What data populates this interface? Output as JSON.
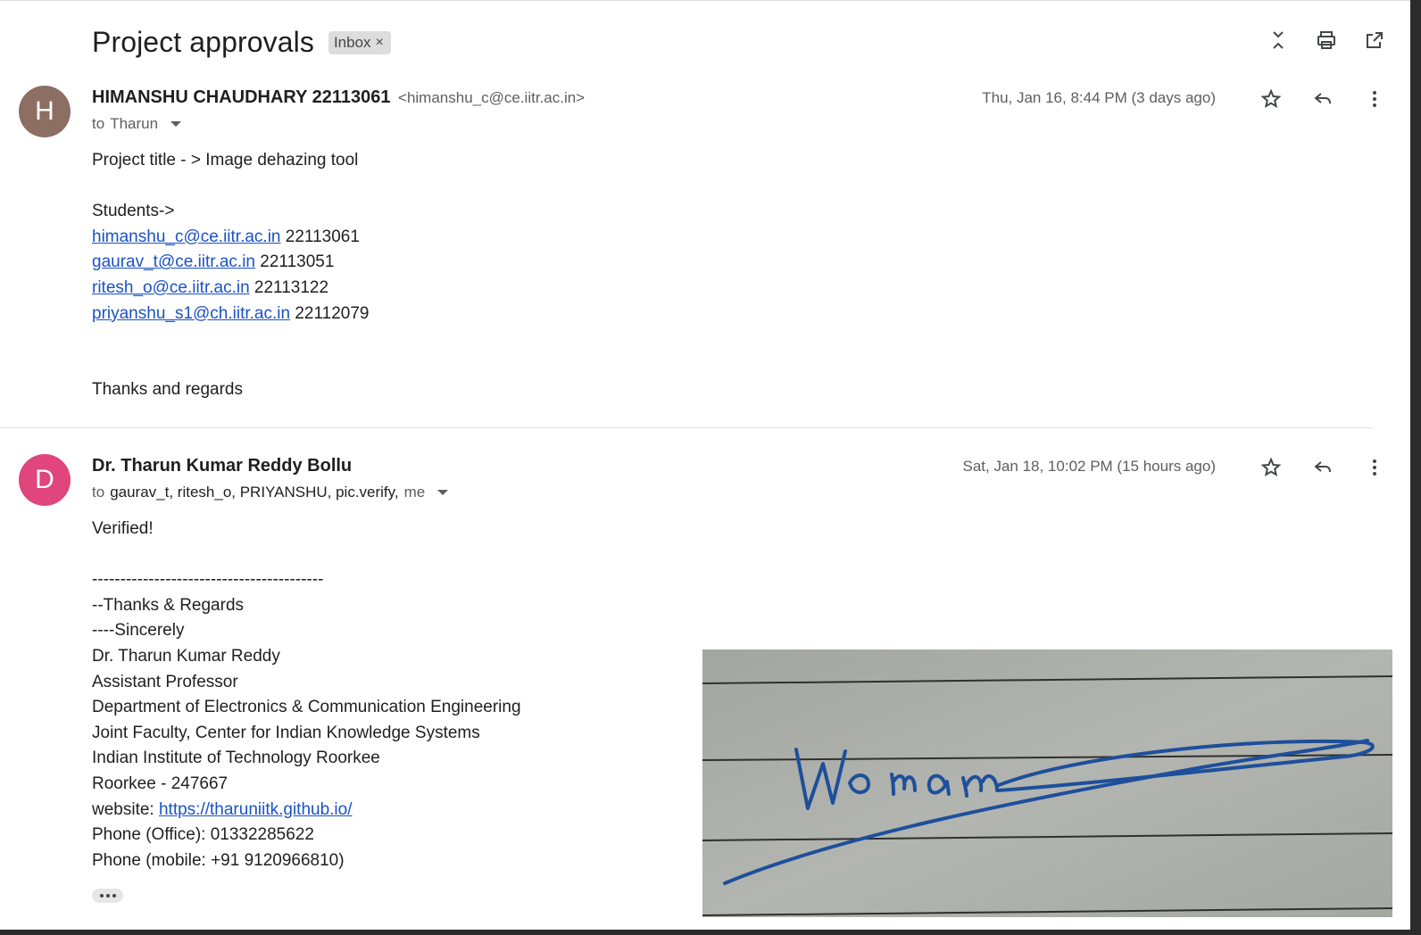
{
  "thread": {
    "subject": "Project approvals",
    "label": "Inbox",
    "label_remove": "×"
  },
  "toolbar_icons": [
    "collapse-all-icon",
    "print-icon",
    "open-in-new-window-icon"
  ],
  "messages": [
    {
      "avatar_letter": "H",
      "avatar_color": "#8c6e63",
      "sender_name": "HIMANSHU CHAUDHARY 22113061",
      "sender_email": "<himanshu_c@ce.iitr.ac.in>",
      "to_prefix": "to",
      "to_names": "Tharun",
      "date": "Thu, Jan 16, 8:44 PM (3 days ago)",
      "body": {
        "line1": "Project title - > Image dehazing tool",
        "line2": "Students->",
        "students": [
          {
            "email": "himanshu_c@ce.iitr.ac.in",
            "id": "22113061"
          },
          {
            "email": "gaurav_t@ce.iitr.ac.in",
            "id": "22113051"
          },
          {
            "email": "ritesh_o@ce.iitr.ac.in",
            "id": "22113122"
          },
          {
            "email": "priyanshu_s1@ch.iitr.ac.in",
            "id": "22112079"
          }
        ],
        "closing": "Thanks and regards"
      }
    },
    {
      "avatar_letter": "D",
      "avatar_color": "#e0457b",
      "sender_name": "Dr. Tharun Kumar Reddy Bollu",
      "to_prefix": "to",
      "to_names": "gaurav_t, ritesh_o, PRIYANSHU, pic.verify,",
      "to_me": "me",
      "date": "Sat, Jan 18, 10:02 PM (15 hours ago)",
      "body": {
        "line1": "Verified!",
        "separator": "-----------------------------------------",
        "sig1": "--Thanks & Regards",
        "sig2": "----Sincerely",
        "sig3": "Dr. Tharun Kumar Reddy",
        "sig4": "Assistant Professor",
        "sig5": "Department of Electronics & Communication Engineering",
        "sig6": "Joint Faculty, Center for Indian Knowledge Systems",
        "sig7": "Indian Institute of Technology Roorkee",
        "sig8": "Roorkee - 247667",
        "website_label": "website:",
        "website_url": "https://tharuniitk.github.io/",
        "phone_office": "Phone (Office): 01332285622",
        "phone_mobile": "Phone (mobile: +91 9120966810)"
      }
    }
  ],
  "signature_image": {
    "description": "handwritten-signature-image",
    "ink_color": "#1d4f9c"
  }
}
